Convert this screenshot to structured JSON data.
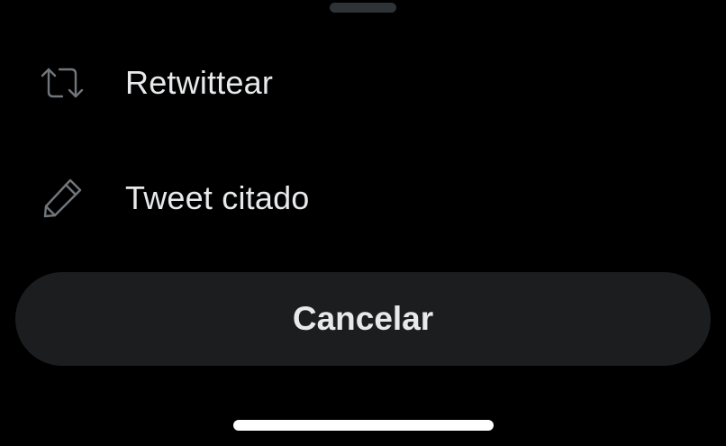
{
  "colors": {
    "background": "#000000",
    "text": "#e7e9ea",
    "icon": "#71767b",
    "cancel_background": "#1c1d1f",
    "grabber": "#2f3336",
    "home_indicator": "#ffffff"
  },
  "menu": {
    "items": [
      {
        "label": "Retwittear",
        "icon": "retweet-icon"
      },
      {
        "label": "Tweet citado",
        "icon": "pencil-icon"
      }
    ]
  },
  "cancel": {
    "label": "Cancelar"
  }
}
